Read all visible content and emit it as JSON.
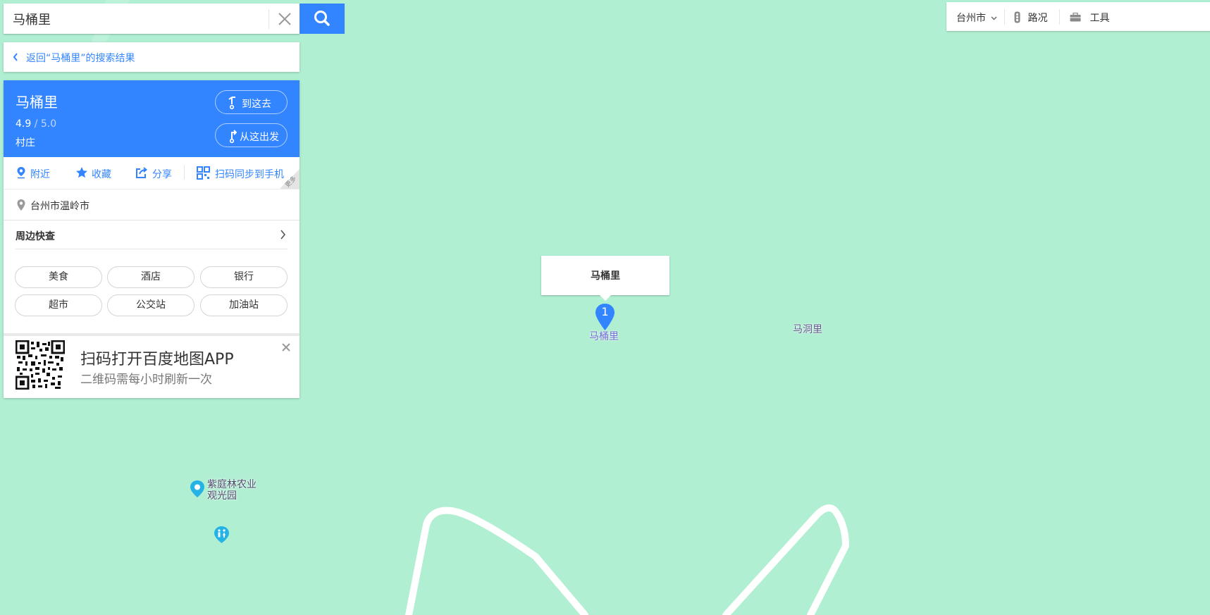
{
  "search": {
    "query": "马桶里"
  },
  "back_link": {
    "label": "返回“马桶里”的搜索结果"
  },
  "poi": {
    "name": "马桶里",
    "rating": "4.9",
    "rating_max": " / 5.0",
    "category": "村庄",
    "go_here_label": "到这去",
    "start_here_label": "从这出发",
    "actions": {
      "nearby": "附近",
      "favorite": "收藏",
      "share": "分享",
      "sync": "扫码同步到手机",
      "more": "更多"
    },
    "address": "台州市温岭市"
  },
  "nearby": {
    "title": "周边快查",
    "tags": [
      "美食",
      "酒店",
      "银行",
      "超市",
      "公交站",
      "加油站"
    ]
  },
  "qr": {
    "title": "扫码打开百度地图APP",
    "subtitle": "二维码需每小时刷新一次"
  },
  "toolbar": {
    "city": "台州市",
    "traffic": "路况",
    "tools": "工具"
  },
  "map": {
    "popup_title": "马桶里",
    "marker_number": "1",
    "marker_label": "马桶里",
    "place_label_1": "马洞里",
    "poi_label_line1": "紫庭林农业",
    "poi_label_line2": "观光园"
  },
  "colors": {
    "map_land": "#b0efd2",
    "accent": "#3385ff",
    "road": "#ffffff",
    "poi_icon": "#25b3e6"
  }
}
